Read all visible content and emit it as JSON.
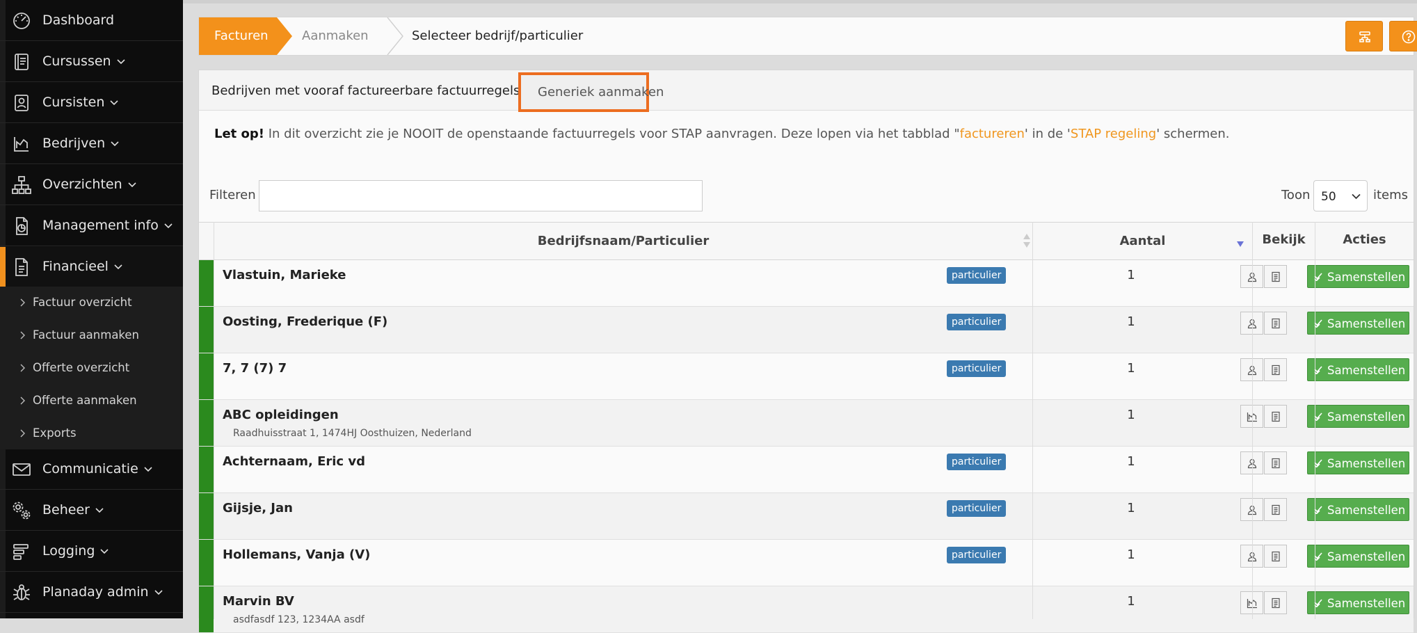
{
  "sidebar": {
    "items": [
      {
        "label": "Dashboard",
        "icon": "dashboard-icon",
        "has_chevron": false
      },
      {
        "label": "Cursussen",
        "icon": "book-icon",
        "has_chevron": true
      },
      {
        "label": "Cursisten",
        "icon": "student-icon",
        "has_chevron": true
      },
      {
        "label": "Bedrijven",
        "icon": "company-chart-icon",
        "has_chevron": true
      },
      {
        "label": "Overzichten",
        "icon": "sitemap-icon",
        "has_chevron": true
      },
      {
        "label": "Management info",
        "icon": "report-icon",
        "has_chevron": true
      },
      {
        "label": "Financieel",
        "icon": "document-icon",
        "has_chevron": true,
        "active": true
      },
      {
        "label": "Communicatie",
        "icon": "envelope-icon",
        "has_chevron": true
      },
      {
        "label": "Beheer",
        "icon": "gears-icon",
        "has_chevron": true
      },
      {
        "label": "Logging",
        "icon": "log-icon",
        "has_chevron": true
      },
      {
        "label": "Planaday admin",
        "icon": "bug-icon",
        "has_chevron": true
      }
    ],
    "submenu": [
      {
        "label": "Factuur overzicht"
      },
      {
        "label": "Factuur aanmaken"
      },
      {
        "label": "Offerte overzicht"
      },
      {
        "label": "Offerte aanmaken"
      },
      {
        "label": "Exports"
      }
    ]
  },
  "breadcrumb": {
    "home": "Facturen",
    "middle": "Aanmaken",
    "current": "Selecteer bedrijf/particulier"
  },
  "tabs": {
    "tab1": "Bedrijven met vooraf factureerbare factuurregels",
    "tab2": "Generiek aanmaken"
  },
  "notice": {
    "bold": "Let op!",
    "part1": " In dit overzicht zie je NOOIT de openstaande factuurregels voor STAP aanvragen. Deze lopen via het tabblad \"",
    "link1": "factureren",
    "part2": "' in de '",
    "link2": "STAP regeling",
    "part3": "' schermen."
  },
  "filter": {
    "label": "Filteren",
    "value": ""
  },
  "pagesize": {
    "label_before": "Toon",
    "value": "50",
    "label_after": "items"
  },
  "table": {
    "headers": {
      "name": "Bedrijfsnaam/Particulier",
      "count": "Aantal",
      "view": "Bekijk",
      "actions": "Acties"
    },
    "action_label": "Samenstellen",
    "rows": [
      {
        "name": "Vlastuin, Marieke",
        "address": "",
        "badge": "particulier",
        "count": "1",
        "type": "person"
      },
      {
        "name": "Oosting, Frederique (F)",
        "address": "",
        "badge": "particulier",
        "count": "1",
        "type": "person"
      },
      {
        "name": "7, 7 (7) 7",
        "address": "",
        "badge": "particulier",
        "count": "1",
        "type": "person"
      },
      {
        "name": "ABC opleidingen",
        "address": "Raadhuisstraat 1, 1474HJ Oosthuizen, Nederland",
        "badge": "",
        "count": "1",
        "type": "company"
      },
      {
        "name": "Achternaam, Eric vd",
        "address": "",
        "badge": "particulier",
        "count": "1",
        "type": "person"
      },
      {
        "name": "Gijsje, Jan",
        "address": "",
        "badge": "particulier",
        "count": "1",
        "type": "person"
      },
      {
        "name": "Hollemans, Vanja (V)",
        "address": "",
        "badge": "particulier",
        "count": "1",
        "type": "person"
      },
      {
        "name": "Marvin BV",
        "address": "asdfasdf 123, 1234AA asdf",
        "badge": "",
        "count": "1",
        "type": "company"
      }
    ]
  },
  "colors": {
    "accent": "#f3911b",
    "highlight_border": "#ec6d20",
    "badge": "#3b7ab0",
    "row_bar": "#2b8a1e",
    "action_button": "#56ad4e"
  }
}
